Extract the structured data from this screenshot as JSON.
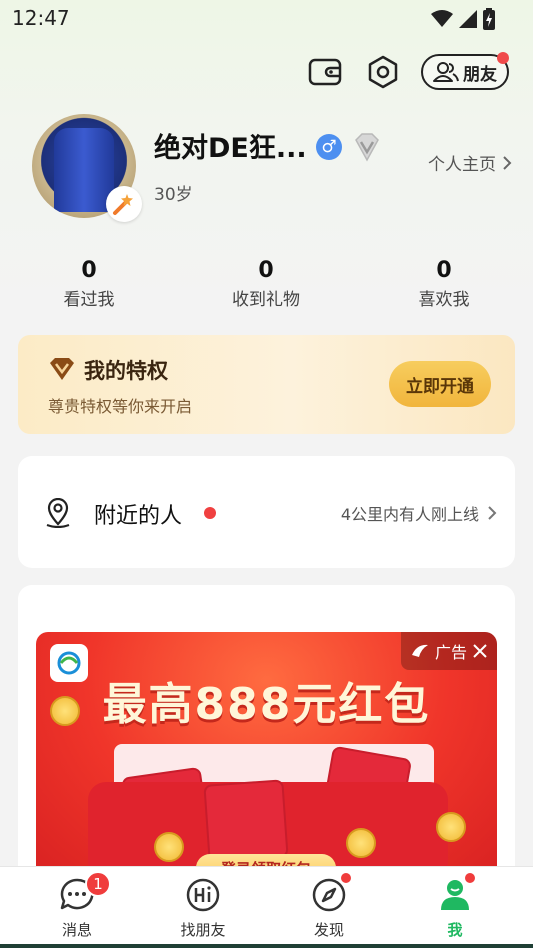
{
  "status_bar": {
    "time": "12:47"
  },
  "header": {
    "friends_label": "朋友"
  },
  "profile": {
    "name": "绝对DE狂...",
    "gender_symbol": "♂",
    "age": "30岁",
    "homepage_link": "个人主页"
  },
  "stats": [
    {
      "value": "0",
      "label": "看过我"
    },
    {
      "value": "0",
      "label": "收到礼物"
    },
    {
      "value": "0",
      "label": "喜欢我"
    }
  ],
  "privilege": {
    "title": "我的特权",
    "subtitle": "尊贵特权等你来开启",
    "button": "立即开通"
  },
  "nearby": {
    "title": "附近的人",
    "description": "4公里内有人刚上线"
  },
  "ad": {
    "tag": "广告",
    "headline": "最高888元红包",
    "cta": "登录领取红包"
  },
  "tabs": [
    {
      "label": "消息",
      "badge": "1"
    },
    {
      "label": "找朋友"
    },
    {
      "label": "发现"
    },
    {
      "label": "我",
      "active": true
    }
  ],
  "colors": {
    "accent_green": "#1fb861",
    "badge_red": "#f03c3c",
    "privilege_gold": "#f1b53c",
    "gender_blue": "#4d8ff0"
  },
  "icons": {
    "header": [
      "wallet-icon",
      "settings-icon",
      "friends-icon"
    ],
    "tabs": [
      "chat-bubble-icon",
      "hi-icon",
      "compass-icon",
      "person-icon"
    ]
  }
}
